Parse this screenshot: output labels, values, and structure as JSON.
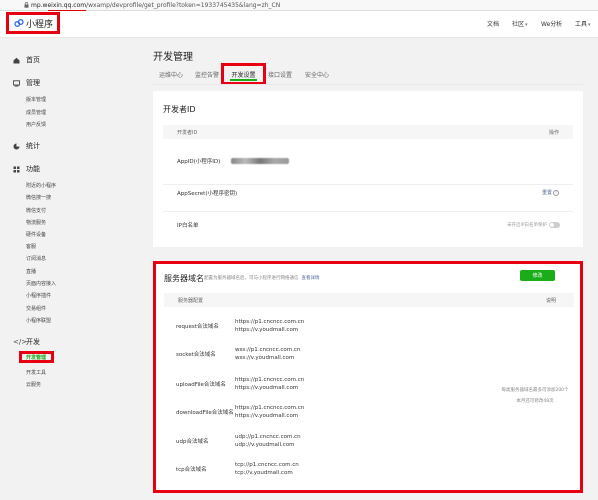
{
  "browser": {
    "url_host": "mp.weixin.qq.com",
    "url_path": "/wxamp/devprofile/get_profile?token=1933745435&lang=zh_CN"
  },
  "header": {
    "logo_text": "小程序",
    "nav": [
      {
        "label": "文档",
        "has_caret": false
      },
      {
        "label": "社区",
        "has_caret": true
      },
      {
        "label": "We分析",
        "has_caret": false
      },
      {
        "label": "工具",
        "has_caret": true
      }
    ]
  },
  "sidebar": {
    "home": "首页",
    "manage": {
      "title": "管理",
      "items": [
        "版本管理",
        "成员管理",
        "用户反馈"
      ]
    },
    "stats": {
      "title": "统计"
    },
    "features": {
      "title": "功能",
      "items": [
        "附近的小程序",
        "微信搜一搜",
        "微信支付",
        "物流服务",
        "硬件设备",
        "客服",
        "订阅消息",
        "直播",
        "页面内容接入",
        "小程序插件",
        "交易组件",
        "小程序联盟"
      ]
    },
    "develop": {
      "title": "开发",
      "items": [
        "开发管理",
        "开发工具",
        "云服务"
      ],
      "active": "开发管理"
    }
  },
  "main": {
    "title": "开发管理",
    "tabs": [
      "运维中心",
      "监控告警",
      "开发设置",
      "接口设置",
      "安全中心"
    ],
    "active_tab": "开发设置",
    "dev_id": {
      "title": "开发者ID",
      "col_id": "开发者ID",
      "col_op": "操作",
      "appid_label": "AppID(小程序ID)",
      "appsecret_label": "AppSecret(小程序密钥)",
      "appsecret_action": "重置",
      "ip_label": "IP白名单",
      "ip_toggle_text": "未开启IP白名单保护"
    },
    "server": {
      "title": "服务器域名",
      "desc": "配置为服务器域名后，可与小程序进行网络通信",
      "desc_link": "查看详情",
      "modify_button": "修改",
      "col_config": "服务器配置",
      "col_desc": "说明",
      "rows": [
        {
          "name": "request合法域名",
          "values": [
            "https://p1.cncncc.com.cn",
            "https://v.youdmall.com"
          ]
        },
        {
          "name": "socket合法域名",
          "values": [
            "wss://p1.cncncc.com.cn",
            "wss://v.youdmall.com"
          ]
        },
        {
          "name": "uploadFile合法域名",
          "values": [
            "https://p1.cncncc.com.cn",
            "https://v.youdmall.com"
          ]
        },
        {
          "name": "downloadFile合法域名",
          "values": [
            "https://p1.cncncc.com.cn",
            "https://v.youdmall.com"
          ]
        },
        {
          "name": "udp合法域名",
          "values": [
            "udp://p1.cncncc.com.cn",
            "udp://v.youdmall.com"
          ]
        },
        {
          "name": "tcp合法域名",
          "values": [
            "tcp://p1.cncncc.com.cn",
            "tcp://v.youdmall.com"
          ]
        }
      ],
      "note_line1": "每类服务器域名最多可添加200个",
      "note_line2": "本月还可修改48次"
    }
  },
  "colors": {
    "accent_green": "#1aad19",
    "highlight_red": "#e60012",
    "link_blue": "#576b95"
  }
}
